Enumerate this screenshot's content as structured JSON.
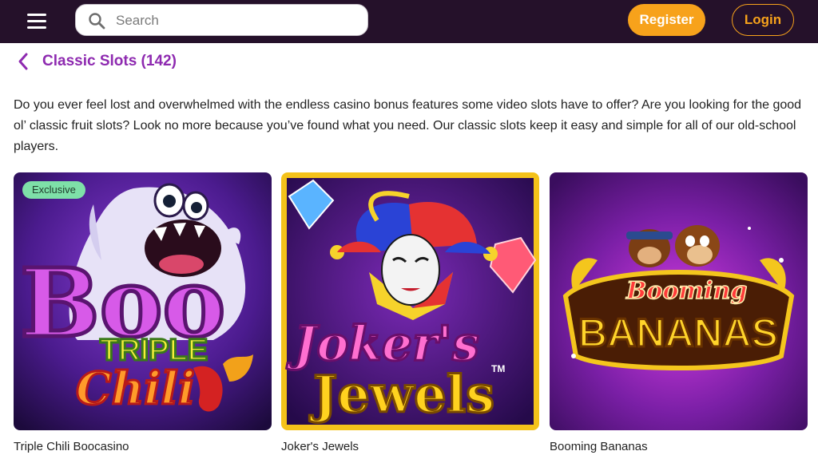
{
  "header": {
    "search_placeholder": "Search",
    "register_label": "Register",
    "login_label": "Login"
  },
  "page": {
    "title": "Classic Slots (142)",
    "description": "Do you ever feel lost and overwhelmed with the endless casino bonus features some video slots have to offer? Are you looking for the good ol’ classic fruit slots? Look no more because you’ve found what you need. Our classic slots keep it easy and simple for all of our old-school players."
  },
  "games": [
    {
      "name": "Triple Chili Boocasino",
      "badge": "Exclusive",
      "art_line1": "Boo",
      "art_line2": "TRIPLE",
      "art_line3": "Chili"
    },
    {
      "name": "Joker's Jewels",
      "art_line1": "Joker's",
      "art_line2": "Jewels",
      "art_mark": "TM"
    },
    {
      "name": "Booming Bananas",
      "art_line1": "Booming",
      "art_line2": "BANANAS"
    }
  ],
  "colors": {
    "topbar": "#25112a",
    "accent_orange": "#f7a21b",
    "title_purple": "#8e2ab0",
    "badge_green": "#7ee0a8"
  },
  "icons": [
    "menu-icon",
    "search-icon",
    "chevron-left-icon"
  ]
}
